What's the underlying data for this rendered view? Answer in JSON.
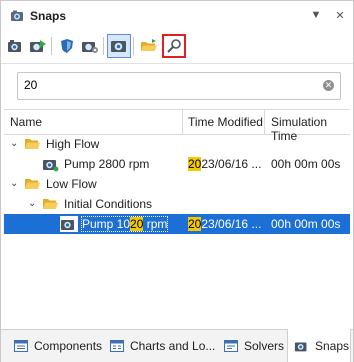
{
  "window": {
    "title": "Snaps",
    "pin_glyph": "▼",
    "close_glyph": "✕"
  },
  "toolbar": {
    "buttons": [
      {
        "name": "take-snap-icon",
        "selected": false,
        "boxed": false
      },
      {
        "name": "restore-snap-icon",
        "selected": false,
        "boxed": false
      },
      {
        "name": "shield-icon",
        "selected": false,
        "boxed": false
      },
      {
        "name": "camera-settings-icon",
        "selected": false,
        "boxed": false
      },
      {
        "name": "camera-view-icon",
        "selected": true,
        "boxed": false
      },
      {
        "name": "folder-open-icon",
        "selected": false,
        "boxed": false
      },
      {
        "name": "search-icon",
        "selected": false,
        "boxed": true
      }
    ]
  },
  "search": {
    "value": "20",
    "clear_glyph": "✕"
  },
  "grid": {
    "headers": {
      "name": "Name",
      "time": "Time Modified",
      "sim": "Simulation Time"
    },
    "rows": {
      "high_flow": {
        "label": "High Flow"
      },
      "pump_2800": {
        "label": "Pump 2800 rpm",
        "time_hl": "20",
        "time_rest": "23/06/16 ...",
        "sim": "00h  00m  00s"
      },
      "low_flow": {
        "label": "Low Flow"
      },
      "initial_conditions": {
        "label": "Initial Conditions"
      },
      "pump_1020": {
        "label_pre": "Pump 10",
        "label_hl": "20",
        "label_post": " rpm",
        "time_hl": "20",
        "time_rest": "23/06/16 ...",
        "sim": "00h  00m  00s"
      }
    },
    "expand_glyph": "⌄"
  },
  "tabs": [
    {
      "label": "Components",
      "icon": "components-icon",
      "active": false
    },
    {
      "label": "Charts and Lo...",
      "icon": "charts-icon",
      "active": false
    },
    {
      "label": "Solvers",
      "icon": "solvers-icon",
      "active": false
    },
    {
      "label": "Snaps",
      "icon": "snaps-icon",
      "active": true
    }
  ],
  "colors": {
    "selection": "#1c6fd5",
    "highlight": "#f4c800",
    "folder": "#f2c14e",
    "accent": "#2b6cb5"
  }
}
